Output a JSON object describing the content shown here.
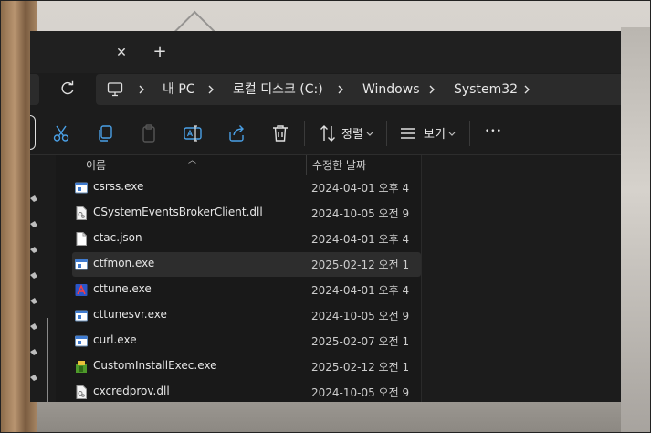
{
  "tabs": {
    "close_glyph": "✕",
    "add_glyph": "+"
  },
  "address": {
    "crumbs": [
      "내 PC",
      "로컬 디스크 (C:)",
      "Windows",
      "System32"
    ]
  },
  "toolbar": {
    "sort_label": "정렬",
    "view_label": "보기",
    "more_glyph": "•••"
  },
  "columns": {
    "name": "이름",
    "modified": "수정한 날짜"
  },
  "files": [
    {
      "name": "csrss.exe",
      "date": "2024-04-01 오후 4",
      "icon": "exe-icon",
      "selected": false
    },
    {
      "name": "CSystemEventsBrokerClient.dll",
      "date": "2024-10-05 오전 9",
      "icon": "dll-icon",
      "selected": false
    },
    {
      "name": "ctac.json",
      "date": "2024-04-01 오후 4",
      "icon": "file-icon",
      "selected": false
    },
    {
      "name": "ctfmon.exe",
      "date": "2025-02-12 오전 1",
      "icon": "exe-icon",
      "selected": true
    },
    {
      "name": "cttune.exe",
      "date": "2024-04-01 오후 4",
      "icon": "cleartype-icon",
      "selected": false
    },
    {
      "name": "cttunesvr.exe",
      "date": "2024-10-05 오전 9",
      "icon": "exe-icon",
      "selected": false
    },
    {
      "name": "curl.exe",
      "date": "2025-02-07 오전 1",
      "icon": "exe-icon",
      "selected": false
    },
    {
      "name": "CustomInstallExec.exe",
      "date": "2025-02-12 오전 1",
      "icon": "installer-icon",
      "selected": false
    },
    {
      "name": "cxcredprov.dll",
      "date": "2024-10-05 오전 9",
      "icon": "dll-icon",
      "selected": false
    }
  ],
  "colors": {
    "window_bg": "#1c1c1c",
    "selection": "#2d2d2d",
    "accent": "#4aa0e6"
  }
}
